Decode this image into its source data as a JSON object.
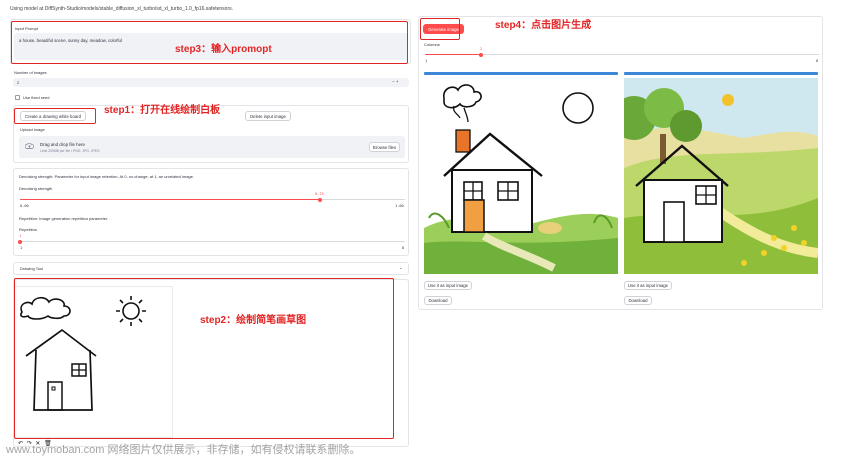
{
  "status_message": "Using model at DiffSynth-Studio/models/stable_diffusion_xl_turbo/sd_xl_turbo_1.0_fp16.safetensors.",
  "prompt": {
    "label": "Input Prompt",
    "value": "a house,  beautiful scene,  sunny day,  meadow,  colorful"
  },
  "num_images": {
    "label": "Number of images",
    "value": "2"
  },
  "fixed_seed": {
    "label": "Use fixed seed",
    "checked": false
  },
  "whiteboard": {
    "create_label": "Create a drawing white board",
    "delete_label": "Delete input image"
  },
  "upload": {
    "label": "Upload image",
    "drop_title": "Drag and drop file here",
    "drop_subtitle": "Limit 200MB per file • PNG, JPG, JPEG",
    "browse_label": "Browse files"
  },
  "denoising": {
    "description": "Denoising strength: Parameter for input image retention, At 0, no change; at 1, an unrelated image.",
    "label": "Denoising strength",
    "value": 0.75,
    "value_text": "0.75",
    "min_text": "0.00",
    "max_text": "1.00"
  },
  "repetition": {
    "description": "Repetition: Image generation repetition parameter.",
    "label": "Repetition",
    "value": 1,
    "value_text": "1",
    "min_text": "1",
    "max_text": "8"
  },
  "drawing_tool": {
    "label": "Drawing Tool"
  },
  "canvas_tools": "↶ ↷ ✕ 🗑",
  "generate": {
    "label": "Generate image"
  },
  "columns": {
    "label": "Columns",
    "value": 2,
    "value_text": "2",
    "min_text": "1",
    "max_text": "8"
  },
  "results": [
    {
      "use_label": "Use it as input image",
      "download_label": "Download"
    },
    {
      "use_label": "Use it as input image",
      "download_label": "Download"
    }
  ],
  "annotations": {
    "step1": "step1：打开在线绘制白板",
    "step2": "step2：绘制简笔画草图",
    "step3": "step3：输入promopt",
    "step4": "step4：点击图片生成"
  },
  "watermark": "www.toymoban.com 网络图片仅供展示，非存储，如有侵权请联系删除。",
  "colors": {
    "accent": "#ff4b4b",
    "annotation": "#e32424",
    "progress_bar": "#3d87d9"
  }
}
